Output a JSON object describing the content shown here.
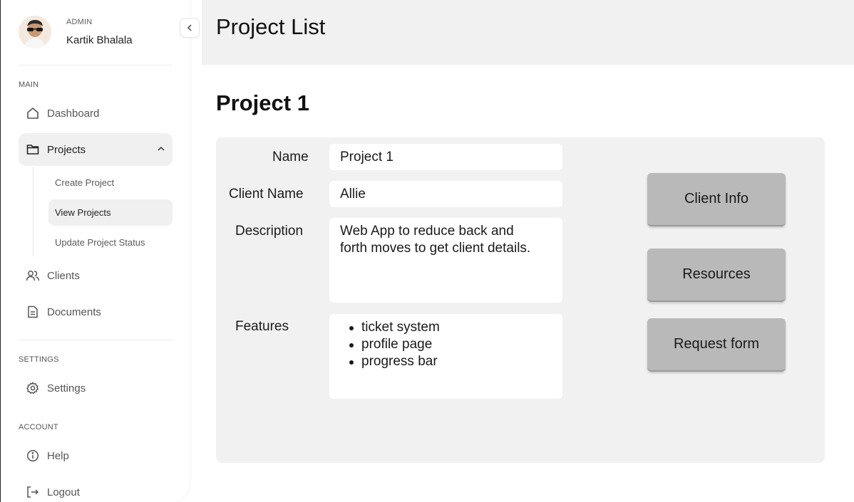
{
  "sidebar": {
    "profile": {
      "role": "ADMIN",
      "name": "Kartik Bhalala"
    },
    "sections": {
      "main": "MAIN",
      "settings": "SETTINGS",
      "account": "ACCOUNT"
    },
    "items": {
      "dashboard": "Dashboard",
      "projects": "Projects",
      "clients": "Clients",
      "documents": "Documents",
      "settings": "Settings",
      "help": "Help",
      "logout": "Logout"
    },
    "project_sub": [
      "Create Project",
      "View Projects",
      "Update Project Status"
    ],
    "active_item": "Projects",
    "active_sub": "View Projects"
  },
  "header": {
    "title": "Project List"
  },
  "project": {
    "heading": "Project 1",
    "fields": {
      "name_label": "Name",
      "name_value": "Project 1",
      "client_label": "Client Name",
      "client_value": "Allie",
      "description_label": "Description",
      "description_value": "Web App to reduce back and forth moves to get client details.",
      "features_label": "Features",
      "features": [
        "ticket system",
        "profile page",
        "progress bar"
      ]
    },
    "actions": [
      "Client Info",
      "Resources",
      "Request form"
    ]
  },
  "colors": {
    "header_bg": "#f1f1f1",
    "card_bg": "#f1f1f1",
    "button_bg": "#b9b9b9",
    "active_nav_bg": "#f0f0f0"
  }
}
